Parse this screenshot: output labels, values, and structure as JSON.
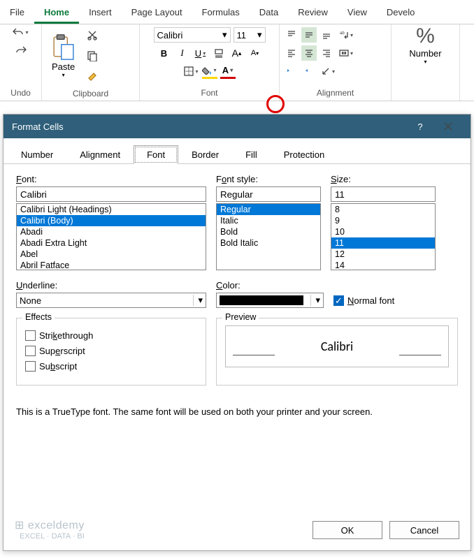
{
  "ribbon": {
    "tabs": [
      "File",
      "Home",
      "Insert",
      "Page Layout",
      "Formulas",
      "Data",
      "Review",
      "View",
      "Develo"
    ],
    "active_tab": "Home",
    "groups": {
      "undo": {
        "label": "Undo"
      },
      "clipboard": {
        "label": "Clipboard",
        "paste": "Paste"
      },
      "font": {
        "label": "Font",
        "font_name": "Calibri",
        "font_size": "11",
        "bold": "B",
        "italic": "I",
        "underline": "U"
      },
      "alignment": {
        "label": "Alignment"
      },
      "number": {
        "label": "Number"
      }
    }
  },
  "dialog": {
    "title": "Format Cells",
    "tabs": [
      "Number",
      "Alignment",
      "Font",
      "Border",
      "Fill",
      "Protection"
    ],
    "active_tab": "Font",
    "font": {
      "label": "Font:",
      "value": "Calibri",
      "options": [
        "Calibri Light (Headings)",
        "Calibri (Body)",
        "Abadi",
        "Abadi Extra Light",
        "Abel",
        "Abril Fatface"
      ],
      "selected": "Calibri (Body)"
    },
    "font_style": {
      "label": "Font style:",
      "value": "Regular",
      "options": [
        "Regular",
        "Italic",
        "Bold",
        "Bold Italic"
      ],
      "selected": "Regular"
    },
    "size": {
      "label": "Size:",
      "value": "11",
      "options": [
        "8",
        "9",
        "10",
        "11",
        "12",
        "14"
      ],
      "selected": "11"
    },
    "underline": {
      "label": "Underline:",
      "value": "None"
    },
    "color": {
      "label": "Color:",
      "value": "#000000"
    },
    "normal_font": {
      "label": "Normal font",
      "checked": true
    },
    "effects": {
      "label": "Effects",
      "strikethrough": {
        "label": "Strikethrough",
        "checked": false
      },
      "superscript": {
        "label": "Superscript",
        "checked": false
      },
      "subscript": {
        "label": "Subscript",
        "checked": false
      }
    },
    "preview": {
      "label": "Preview",
      "text": "Calibri"
    },
    "info": "This is a TrueType font.  The same font will be used on both your printer and your screen.",
    "buttons": {
      "ok": "OK",
      "cancel": "Cancel"
    }
  },
  "watermark": {
    "brand": "exceldemy",
    "tag": "EXCEL · DATA · BI"
  }
}
